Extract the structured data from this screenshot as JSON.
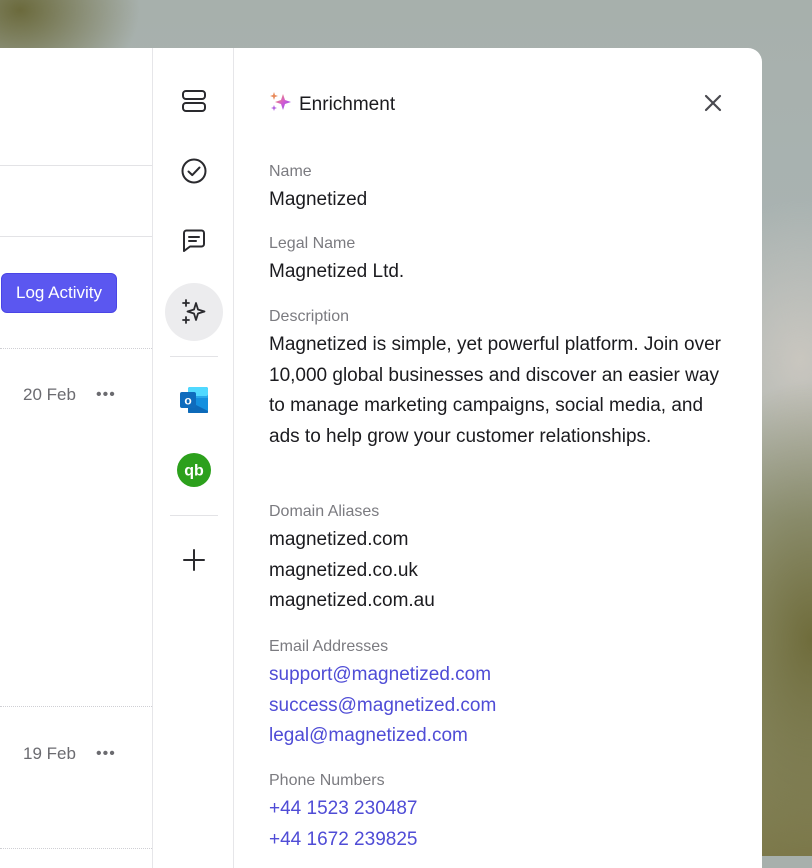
{
  "list": {
    "log_activity_label": "Log Activity",
    "rows": [
      {
        "date": "20 Feb",
        "more": "•••"
      },
      {
        "date": "19 Feb",
        "more": "•••"
      }
    ]
  },
  "rail": {
    "items": [
      "layout-icon",
      "check-circle-icon",
      "comment-icon",
      "sparkle-icon",
      "outlook-icon",
      "quickbooks-icon",
      "plus-icon"
    ],
    "active": "sparkle-icon",
    "outlook_letter": "o",
    "quickbooks_letters": "qb"
  },
  "enrichment": {
    "title": "Enrichment",
    "name_label": "Name",
    "name_value": "Magnetized",
    "legal_name_label": "Legal Name",
    "legal_name_value": "Magnetized Ltd.",
    "description_label": "Description",
    "description_value": "Magnetized is simple, yet powerful platform. Join over 10,000 global businesses and discover an easier way to manage marketing campaigns, social media, and ads to help grow your customer relationships.",
    "domain_aliases_label": "Domain Aliases",
    "domain_aliases": [
      "magnetized.com",
      "magnetized.co.uk",
      "magnetized.com.au"
    ],
    "email_addresses_label": "Email Addresses",
    "email_addresses": [
      "support@magnetized.com",
      "success@magnetized.com",
      "legal@magnetized.com"
    ],
    "phone_numbers_label": "Phone Numbers",
    "phone_numbers": [
      "+44 1523 230487",
      "+44 1672 239825"
    ]
  },
  "colors": {
    "accent": "#5b57f0",
    "link": "#4f4cd6",
    "outlook_blue": "#0f6cbd",
    "quickbooks_green": "#2ca01c"
  }
}
